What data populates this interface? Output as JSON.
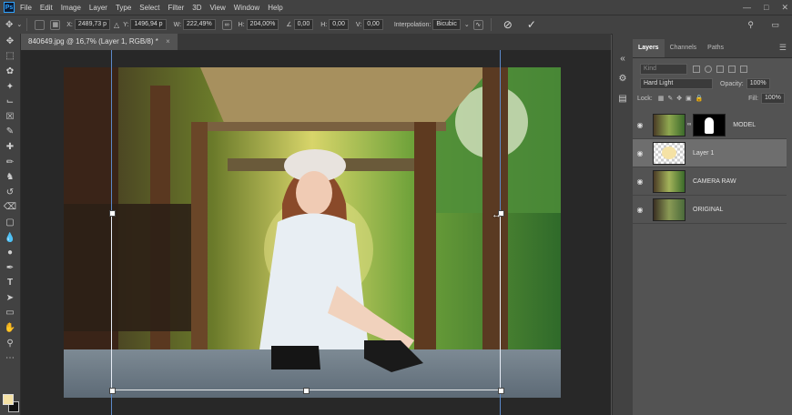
{
  "menu": [
    "File",
    "Edit",
    "Image",
    "Layer",
    "Type",
    "Select",
    "Filter",
    "3D",
    "View",
    "Window",
    "Help"
  ],
  "options": {
    "x_label": "X:",
    "x_value": "2489,73 p",
    "y_label": "Y:",
    "y_value": "1496,94 p",
    "w_label": "W:",
    "w_value": "222,49%",
    "h_label": "H:",
    "h_value": "204,00%",
    "angle_value": "0,00",
    "hskew_label": "H:",
    "hskew_value": "0,00",
    "vskew_label": "V:",
    "vskew_value": "0,00",
    "interp_label": "Interpolation:",
    "interp_value": "Bicubic"
  },
  "document": {
    "tab_title": "840649.jpg @ 16,7% (Layer 1, RGB/8) *"
  },
  "panel": {
    "tabs": [
      "Layers",
      "Channels",
      "Paths"
    ],
    "kind_placeholder": "Kind",
    "blend_mode": "Hard Light",
    "opacity_label": "Opacity:",
    "opacity_value": "100%",
    "lock_label": "Lock:",
    "fill_label": "Fill:",
    "fill_value": "100%",
    "layers": [
      {
        "name": "MODEL",
        "has_mask": true
      },
      {
        "name": "Layer 1",
        "selected": true
      },
      {
        "name": "CAMERA RAW"
      },
      {
        "name": "ORIGINAL"
      }
    ]
  },
  "colors": {
    "foreground": "#f5e2a5",
    "background": "#111111",
    "guide": "#5c89c9"
  }
}
